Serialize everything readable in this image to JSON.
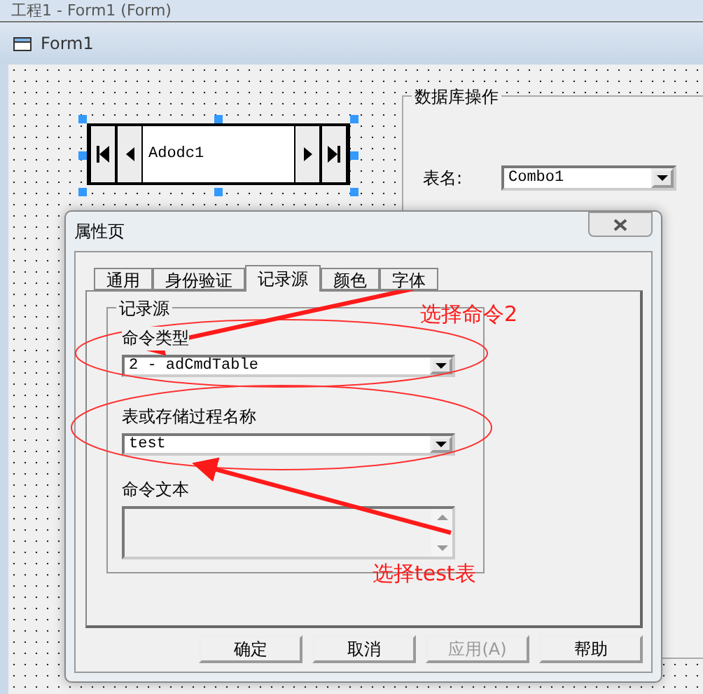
{
  "ide_title": "工程1 - Form1 (Form)",
  "form": {
    "title": "Form1",
    "adodc": {
      "caption": "Adodc1"
    },
    "frame": {
      "caption": "数据库操作",
      "label": "表名:",
      "combo": "Combo1"
    }
  },
  "dialog": {
    "title": "属性页",
    "tabs": [
      {
        "label": "通用",
        "selected": false
      },
      {
        "label": "身份验证",
        "selected": false
      },
      {
        "label": "记录源",
        "selected": true
      },
      {
        "label": "颜色",
        "selected": false
      },
      {
        "label": "字体",
        "selected": false
      }
    ],
    "group": "记录源",
    "command_type": {
      "label": "命令类型",
      "value": "2 - adCmdTable"
    },
    "table_name": {
      "label": "表或存储过程名称",
      "value": "test"
    },
    "command_text": {
      "label": "命令文本"
    },
    "buttons": [
      {
        "label": "确定",
        "disabled": false
      },
      {
        "label": "取消",
        "disabled": false
      },
      {
        "label": "应用(A)",
        "disabled": true
      },
      {
        "label": "帮助",
        "disabled": false
      }
    ]
  },
  "annotations": [
    "选择命令2",
    "选择test表"
  ]
}
